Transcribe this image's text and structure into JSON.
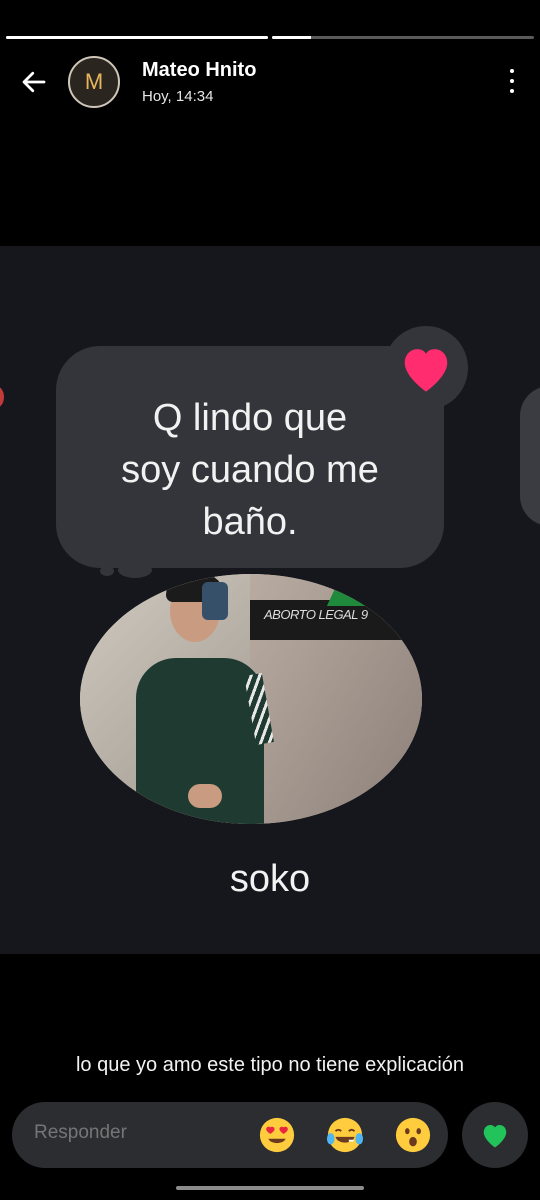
{
  "progress": {
    "segments": [
      1.0,
      0.15
    ]
  },
  "header": {
    "avatar_initial": "M",
    "name": "Mateo Hnito",
    "time": "Hoy, 14:34"
  },
  "story": {
    "bubble_lines": [
      "Q lindo que",
      "soy cuando me",
      "baño."
    ],
    "photo_banner": "ABORTO LEGAL 9",
    "name": "soko"
  },
  "caption": "lo que yo amo este tipo no tiene explicación",
  "reply": {
    "placeholder": "Responder",
    "emojis": [
      "heart-eyes-emoji",
      "tears-of-joy-emoji",
      "surprised-emoji"
    ]
  },
  "colors": {
    "reaction_heart": "#ff2d6f",
    "like_heart": "#21c35a",
    "avatar_text": "#e8b75a"
  }
}
